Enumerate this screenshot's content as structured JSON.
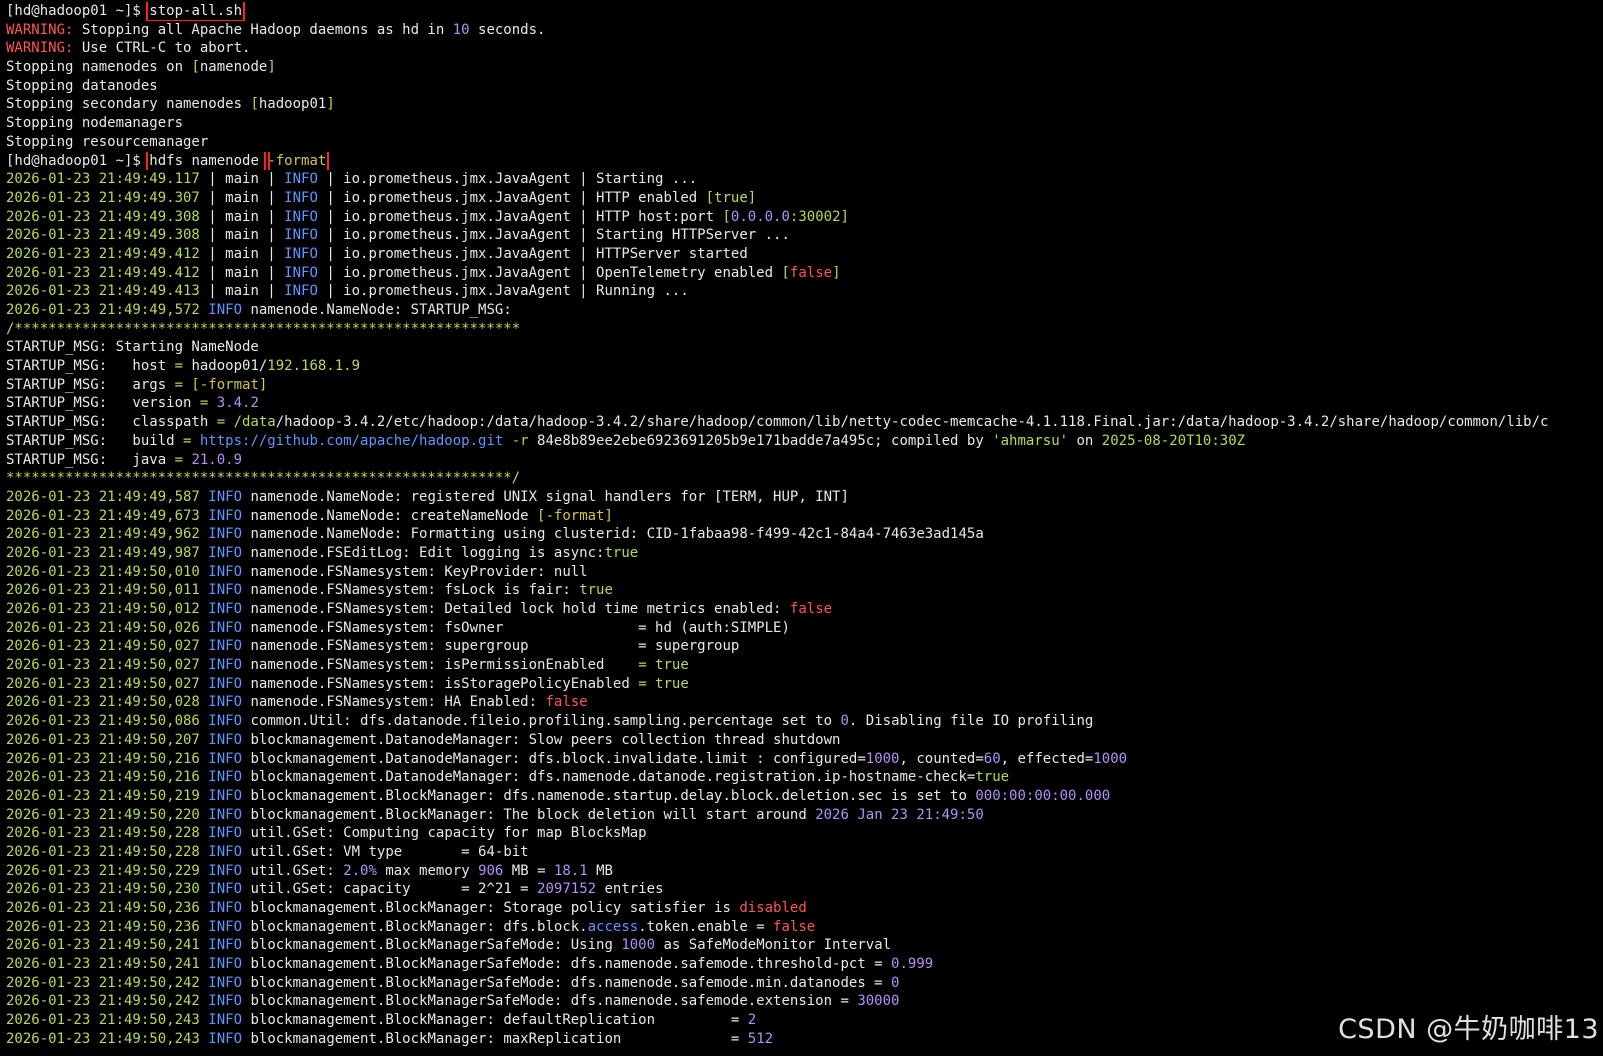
{
  "colors": {
    "w": "#e8e8e8",
    "g": "#b7d95a",
    "r": "#ff5555",
    "p": "#b390f5",
    "b": "#5e96ff",
    "y": "#d2c24a",
    "t": "#cfcfcf"
  },
  "watermark": "CSDN @牛奶咖啡13",
  "lines": [
    [
      [
        "w",
        "[hd@hadoop01 ~]$ "
      ],
      [
        "w",
        "stop-all.sh",
        "hl"
      ]
    ],
    [
      [
        "r",
        "WARNING: "
      ],
      [
        "w",
        "Stopping all Apache Hadoop daemons as hd in "
      ],
      [
        "p",
        "10"
      ],
      [
        "w",
        " seconds."
      ]
    ],
    [
      [
        "r",
        "WARNING: "
      ],
      [
        "w",
        "Use CTRL-C to abort."
      ]
    ],
    [
      [
        "w",
        "Stopping namenodes on "
      ],
      [
        "g",
        "["
      ],
      [
        "w",
        "namenode"
      ],
      [
        "g",
        "]"
      ]
    ],
    [
      [
        "w",
        "Stopping datanodes"
      ]
    ],
    [
      [
        "w",
        "Stopping secondary namenodes "
      ],
      [
        "g",
        "["
      ],
      [
        "w",
        "hadoop01"
      ],
      [
        "g",
        "]"
      ]
    ],
    [
      [
        "w",
        "Stopping nodemanagers"
      ]
    ],
    [
      [
        "w",
        "Stopping resourcemanager"
      ]
    ],
    [
      [
        "w",
        "[hd@hadoop01 ~]$ "
      ],
      [
        "w",
        "hdfs namenode ",
        "hl"
      ],
      [
        "y",
        "-format",
        "hl"
      ]
    ],
    [
      [
        "g",
        "2026-01-23 21:49:49.117"
      ],
      [
        "w",
        " | main | "
      ],
      [
        "b",
        "INFO"
      ],
      [
        "w",
        " | io.prometheus.jmx.JavaAgent | Starting ..."
      ]
    ],
    [
      [
        "g",
        "2026-01-23 21:49:49.307"
      ],
      [
        "w",
        " | main | "
      ],
      [
        "b",
        "INFO"
      ],
      [
        "w",
        " | io.prometheus.jmx.JavaAgent | HTTP enabled "
      ],
      [
        "g",
        "[true]"
      ]
    ],
    [
      [
        "g",
        "2026-01-23 21:49:49.308"
      ],
      [
        "w",
        " | main | "
      ],
      [
        "b",
        "INFO"
      ],
      [
        "w",
        " | io.prometheus.jmx.JavaAgent | HTTP host:port "
      ],
      [
        "g",
        "["
      ],
      [
        "p",
        "0.0.0.0"
      ],
      [
        "g",
        ":30002]"
      ]
    ],
    [
      [
        "g",
        "2026-01-23 21:49:49.308"
      ],
      [
        "w",
        " | main | "
      ],
      [
        "b",
        "INFO"
      ],
      [
        "w",
        " | io.prometheus.jmx.JavaAgent | Starting HTTPServer ..."
      ]
    ],
    [
      [
        "g",
        "2026-01-23 21:49:49.412"
      ],
      [
        "w",
        " | main | "
      ],
      [
        "b",
        "INFO"
      ],
      [
        "w",
        " | io.prometheus.jmx.JavaAgent | HTTPServer started"
      ]
    ],
    [
      [
        "g",
        "2026-01-23 21:49:49.412"
      ],
      [
        "w",
        " | main | "
      ],
      [
        "b",
        "INFO"
      ],
      [
        "w",
        " | io.prometheus.jmx.JavaAgent | OpenTelemetry enabled "
      ],
      [
        "g",
        "["
      ],
      [
        "r",
        "false"
      ],
      [
        "g",
        "]"
      ]
    ],
    [
      [
        "g",
        "2026-01-23 21:49:49.413"
      ],
      [
        "w",
        " | main | "
      ],
      [
        "b",
        "INFO"
      ],
      [
        "w",
        " | io.prometheus.jmx.JavaAgent | Running ..."
      ]
    ],
    [
      [
        "g",
        "2026-01-23 21:49:49,572"
      ],
      [
        "b",
        " INFO"
      ],
      [
        "w",
        " namenode.NameNode: STARTUP_MSG:"
      ]
    ],
    [
      [
        "g",
        "/************************************************************"
      ]
    ],
    [
      [
        "w",
        "STARTUP_MSG: Starting NameNode"
      ]
    ],
    [
      [
        "w",
        "STARTUP_MSG:   host "
      ],
      [
        "g",
        "= "
      ],
      [
        "w",
        "hadoop01/"
      ],
      [
        "g",
        "192.168.1.9"
      ]
    ],
    [
      [
        "w",
        "STARTUP_MSG:   args "
      ],
      [
        "g",
        "= ["
      ],
      [
        "y",
        "-format"
      ],
      [
        "g",
        "]"
      ]
    ],
    [
      [
        "w",
        "STARTUP_MSG:   version "
      ],
      [
        "g",
        "= "
      ],
      [
        "p",
        "3.4.2"
      ]
    ],
    [
      [
        "w",
        "STARTUP_MSG:   classpath "
      ],
      [
        "g",
        "= /data"
      ],
      [
        "w",
        "/hadoop-3.4.2/etc/hadoop:/data/hadoop-3.4.2/share/hadoop/common/lib/netty-codec-memcache-4.1.118.Final.jar:/data/hadoop-3.4.2/share/hadoop/common/lib/c"
      ]
    ],
    [
      [
        "w",
        "STARTUP_MSG:   build "
      ],
      [
        "g",
        "= "
      ],
      [
        "b",
        "https://github.com/apache/hadoop.git"
      ],
      [
        "y",
        " -r"
      ],
      [
        "w",
        " 84e8b89ee2ebe6923691205b9e171badde7a495c; compiled by "
      ],
      [
        "g",
        "'ahmarsu'"
      ],
      [
        "w",
        " on "
      ],
      [
        "g",
        "2025-08-20T10:30Z"
      ]
    ],
    [
      [
        "w",
        "STARTUP_MSG:   java "
      ],
      [
        "g",
        "= "
      ],
      [
        "p",
        "21.0.9"
      ]
    ],
    [
      [
        "g",
        "************************************************************/"
      ]
    ],
    [
      [
        "g",
        "2026-01-23 21:49:49,587"
      ],
      [
        "b",
        " INFO"
      ],
      [
        "w",
        " namenode.NameNode: registered UNIX signal handlers for [TERM, HUP, INT]"
      ]
    ],
    [
      [
        "g",
        "2026-01-23 21:49:49,673"
      ],
      [
        "b",
        " INFO"
      ],
      [
        "w",
        " namenode.NameNode: createNameNode "
      ],
      [
        "g",
        "["
      ],
      [
        "y",
        "-format"
      ],
      [
        "g",
        "]"
      ]
    ],
    [
      [
        "g",
        "2026-01-23 21:49:49,962"
      ],
      [
        "b",
        " INFO"
      ],
      [
        "w",
        " namenode.NameNode: Formatting using clusterid: CID-1fabaa98-f499-42c1-84a4-7463e3ad145a"
      ]
    ],
    [
      [
        "g",
        "2026-01-23 21:49:49,987"
      ],
      [
        "b",
        " INFO"
      ],
      [
        "w",
        " namenode.FSEditLog: Edit logging is async:"
      ],
      [
        "g",
        "true"
      ]
    ],
    [
      [
        "g",
        "2026-01-23 21:49:50,010"
      ],
      [
        "b",
        " INFO"
      ],
      [
        "w",
        " namenode.FSNamesystem: KeyProvider: null"
      ]
    ],
    [
      [
        "g",
        "2026-01-23 21:49:50,011"
      ],
      [
        "b",
        " INFO"
      ],
      [
        "w",
        " namenode.FSNamesystem: fsLock is fair: "
      ],
      [
        "g",
        "true"
      ]
    ],
    [
      [
        "g",
        "2026-01-23 21:49:50,012"
      ],
      [
        "b",
        " INFO"
      ],
      [
        "w",
        " namenode.FSNamesystem: Detailed lock hold time metrics enabled: "
      ],
      [
        "r",
        "false"
      ]
    ],
    [
      [
        "g",
        "2026-01-23 21:49:50,026"
      ],
      [
        "b",
        " INFO"
      ],
      [
        "w",
        " namenode.FSNamesystem: fsOwner                = hd (auth:SIMPLE)"
      ]
    ],
    [
      [
        "g",
        "2026-01-23 21:49:50,027"
      ],
      [
        "b",
        " INFO"
      ],
      [
        "w",
        " namenode.FSNamesystem: supergroup             = supergroup"
      ]
    ],
    [
      [
        "g",
        "2026-01-23 21:49:50,027"
      ],
      [
        "b",
        " INFO"
      ],
      [
        "w",
        " namenode.FSNamesystem: isPermissionEnabled    "
      ],
      [
        "g",
        "= true"
      ]
    ],
    [
      [
        "g",
        "2026-01-23 21:49:50,027"
      ],
      [
        "b",
        " INFO"
      ],
      [
        "w",
        " namenode.FSNamesystem: isStoragePolicyEnabled "
      ],
      [
        "g",
        "= true"
      ]
    ],
    [
      [
        "g",
        "2026-01-23 21:49:50,028"
      ],
      [
        "b",
        " INFO"
      ],
      [
        "w",
        " namenode.FSNamesystem: HA Enabled: "
      ],
      [
        "r",
        "false"
      ]
    ],
    [
      [
        "g",
        "2026-01-23 21:49:50,086"
      ],
      [
        "b",
        " INFO"
      ],
      [
        "w",
        " common.Util: dfs.datanode.fileio.profiling.sampling.percentage set to "
      ],
      [
        "p",
        "0"
      ],
      [
        "w",
        ". Disabling file IO profiling"
      ]
    ],
    [
      [
        "g",
        "2026-01-23 21:49:50,207"
      ],
      [
        "b",
        " INFO"
      ],
      [
        "w",
        " blockmanagement.DatanodeManager: Slow peers collection thread shutdown"
      ]
    ],
    [
      [
        "g",
        "2026-01-23 21:49:50,216"
      ],
      [
        "b",
        " INFO"
      ],
      [
        "w",
        " blockmanagement.DatanodeManager: dfs.block.invalidate.limit : configured="
      ],
      [
        "p",
        "1000"
      ],
      [
        "w",
        ", counted="
      ],
      [
        "p",
        "60"
      ],
      [
        "w",
        ", effected="
      ],
      [
        "p",
        "1000"
      ]
    ],
    [
      [
        "g",
        "2026-01-23 21:49:50,216"
      ],
      [
        "b",
        " INFO"
      ],
      [
        "w",
        " blockmanagement.DatanodeManager: dfs.namenode.datanode.registration.ip-hostname-check="
      ],
      [
        "g",
        "true"
      ]
    ],
    [
      [
        "g",
        "2026-01-23 21:49:50,219"
      ],
      [
        "b",
        " INFO"
      ],
      [
        "w",
        " blockmanagement.BlockManager: dfs.namenode.startup.delay.block.deletion.sec is set to "
      ],
      [
        "p",
        "000:00:00:00.000"
      ]
    ],
    [
      [
        "g",
        "2026-01-23 21:49:50,220"
      ],
      [
        "b",
        " INFO"
      ],
      [
        "w",
        " blockmanagement.BlockManager: The block deletion will start around "
      ],
      [
        "p",
        "2026 Jan 23 21:49:50"
      ]
    ],
    [
      [
        "g",
        "2026-01-23 21:49:50,228"
      ],
      [
        "b",
        " INFO"
      ],
      [
        "w",
        " util.GSet: Computing capacity for map BlocksMap"
      ]
    ],
    [
      [
        "g",
        "2026-01-23 21:49:50,228"
      ],
      [
        "b",
        " INFO"
      ],
      [
        "w",
        " util.GSet: VM type       = 64-bit"
      ]
    ],
    [
      [
        "g",
        "2026-01-23 21:49:50,229"
      ],
      [
        "b",
        " INFO"
      ],
      [
        "w",
        " util.GSet: "
      ],
      [
        "p",
        "2.0%"
      ],
      [
        "w",
        " max memory "
      ],
      [
        "p",
        "906"
      ],
      [
        "w",
        " MB = "
      ],
      [
        "p",
        "18.1"
      ],
      [
        "w",
        " MB"
      ]
    ],
    [
      [
        "g",
        "2026-01-23 21:49:50,230"
      ],
      [
        "b",
        " INFO"
      ],
      [
        "w",
        " util.GSet: capacity      = 2^21 = "
      ],
      [
        "p",
        "2097152"
      ],
      [
        "w",
        " entries"
      ]
    ],
    [
      [
        "g",
        "2026-01-23 21:49:50,236"
      ],
      [
        "b",
        " INFO"
      ],
      [
        "w",
        " blockmanagement.BlockManager: Storage policy satisfier is "
      ],
      [
        "r",
        "disabled"
      ]
    ],
    [
      [
        "g",
        "2026-01-23 21:49:50,236"
      ],
      [
        "b",
        " INFO"
      ],
      [
        "w",
        " blockmanagement.BlockManager: dfs.block."
      ],
      [
        "b",
        "access"
      ],
      [
        "w",
        ".token.enable = "
      ],
      [
        "r",
        "false"
      ]
    ],
    [
      [
        "g",
        "2026-01-23 21:49:50,241"
      ],
      [
        "b",
        " INFO"
      ],
      [
        "w",
        " blockmanagement.BlockManagerSafeMode: Using "
      ],
      [
        "p",
        "1000"
      ],
      [
        "w",
        " as SafeModeMonitor Interval"
      ]
    ],
    [
      [
        "g",
        "2026-01-23 21:49:50,241"
      ],
      [
        "b",
        " INFO"
      ],
      [
        "w",
        " blockmanagement.BlockManagerSafeMode: dfs.namenode.safemode.threshold-pct = "
      ],
      [
        "p",
        "0.999"
      ]
    ],
    [
      [
        "g",
        "2026-01-23 21:49:50,242"
      ],
      [
        "b",
        " INFO"
      ],
      [
        "w",
        " blockmanagement.BlockManagerSafeMode: dfs.namenode.safemode.min.datanodes = "
      ],
      [
        "p",
        "0"
      ]
    ],
    [
      [
        "g",
        "2026-01-23 21:49:50,242"
      ],
      [
        "b",
        " INFO"
      ],
      [
        "w",
        " blockmanagement.BlockManagerSafeMode: dfs.namenode.safemode.extension = "
      ],
      [
        "p",
        "30000"
      ]
    ],
    [
      [
        "g",
        "2026-01-23 21:49:50,243"
      ],
      [
        "b",
        " INFO"
      ],
      [
        "w",
        " blockmanagement.BlockManager: defaultReplication         = "
      ],
      [
        "p",
        "2"
      ]
    ],
    [
      [
        "g",
        "2026-01-23 21:49:50,243"
      ],
      [
        "b",
        " INFO"
      ],
      [
        "w",
        " blockmanagement.BlockManager: maxReplication             = "
      ],
      [
        "p",
        "512"
      ]
    ]
  ]
}
